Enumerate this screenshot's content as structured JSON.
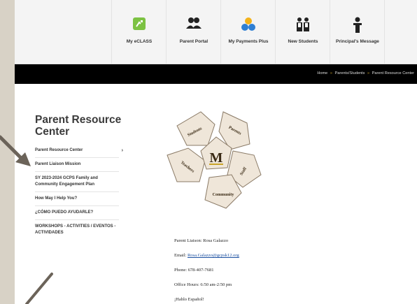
{
  "quick_links": [
    {
      "label": "My eCLASS",
      "icon": "eclass-icon"
    },
    {
      "label": "Parent Portal",
      "icon": "parents-icon"
    },
    {
      "label": "My Payments Plus",
      "icon": "payments-icon"
    },
    {
      "label": "New Students",
      "icon": "new-students-icon"
    },
    {
      "label": "Principal's Message",
      "icon": "principal-icon"
    }
  ],
  "breadcrumb": {
    "home": "Home",
    "section": "Parents/Students",
    "current": "Parent Resource Center",
    "separator": "»"
  },
  "sidebar": {
    "title": "Parent Resource Center",
    "items": [
      {
        "label": "Parent Resource Center"
      },
      {
        "label": "Parent Liaison Mission"
      },
      {
        "label": "SY 2023-2024 GCPS Family and Community Engagement Plan"
      },
      {
        "label": "How May I Help You?"
      },
      {
        "label": "¿CÓMO PUEDO AYUDARLE?"
      },
      {
        "label": "WORKSHOPS - ACTIVITIES / EVENTOS - ACTIVIDADES"
      }
    ]
  },
  "logo": {
    "center_letter": "M",
    "petals": [
      "Students",
      "Parents",
      "Staff",
      "Community",
      "Teachers"
    ]
  },
  "contact": {
    "liaison": "Parent Liaison: Rosa Galazzo",
    "email_label": "Email:",
    "email": "Rosa.Galazzo@gcpsk12.org",
    "phone": "Phone: 678-407-7681",
    "hours": "Office Hours: 6:50 am-2:50 pm",
    "spanish": "¡Hablo Español!"
  },
  "colors": {
    "eclass_green": "#7cc242",
    "payments_blue": "#2f7fd3",
    "payments_yellow": "#f3b21a",
    "petal_fill": "#efe6d9",
    "petal_stroke": "#8a7a66",
    "logo_gold": "#c9a227",
    "arrow": "#6b6359"
  }
}
